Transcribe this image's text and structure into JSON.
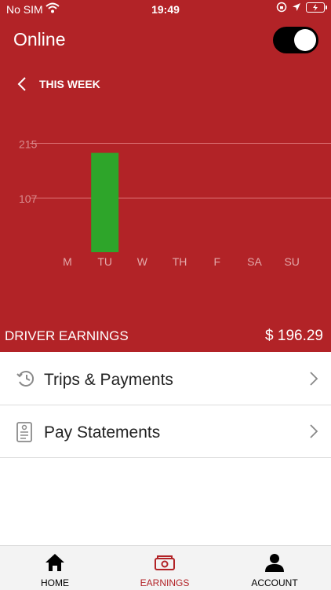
{
  "status_bar": {
    "carrier": "No SIM",
    "time": "19:49"
  },
  "header": {
    "title": "Online",
    "toggle_on": true
  },
  "period": {
    "label": "THIS WEEK"
  },
  "chart_data": {
    "type": "bar",
    "categories": [
      "M",
      "TU",
      "W",
      "TH",
      "F",
      "SA",
      "SU"
    ],
    "values": [
      0,
      196.29,
      0,
      0,
      0,
      0,
      0
    ],
    "yticks": [
      107,
      215
    ],
    "ylim": [
      0,
      250
    ],
    "grid": true,
    "bar_color": "#2ea52a"
  },
  "earnings": {
    "label": "DRIVER EARNINGS",
    "value": "$ 196.29"
  },
  "menu": {
    "items": [
      {
        "label": "Trips & Payments",
        "icon": "history-clock-icon"
      },
      {
        "label": "Pay Statements",
        "icon": "statement-document-icon"
      }
    ]
  },
  "tabs": [
    {
      "label": "HOME",
      "icon": "home-icon",
      "active": false
    },
    {
      "label": "EARNINGS",
      "icon": "money-icon",
      "active": true
    },
    {
      "label": "ACCOUNT",
      "icon": "person-icon",
      "active": false
    }
  ],
  "colors": {
    "header_red": "#b22327",
    "bar_green": "#2ea52a",
    "active_tab": "#b22327"
  }
}
